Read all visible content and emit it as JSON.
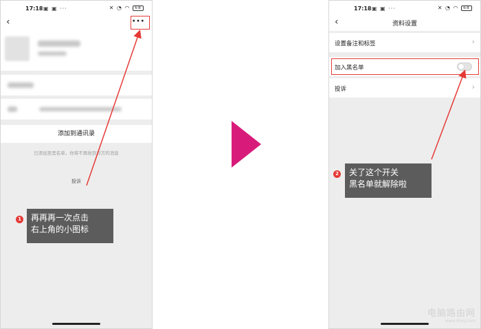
{
  "status_bar": {
    "time": "17:18",
    "battery": "68"
  },
  "left_phone": {
    "add_contact_label": "添加到通讯录",
    "blacklist_hint": "已添加至黑名单，你将不再收到对方的消息",
    "complain_link": "投诉",
    "more_icon": "···"
  },
  "right_phone": {
    "title": "资料设置",
    "rows": [
      {
        "label": "设置备注和标签"
      },
      {
        "label": "加入黑名单"
      },
      {
        "label": "投诉"
      }
    ]
  },
  "callouts": [
    {
      "badge": "1",
      "line1": "再再再一次点击",
      "line2": "右上角的小图标"
    },
    {
      "badge": "2",
      "line1": "关了这个开关",
      "line2": "黑名单就解除啦"
    }
  ],
  "watermark": {
    "line1": "电脑路由网",
    "line2": "www.dnxy.com"
  },
  "colors": {
    "accent_red": "#e53935",
    "step_arrow": "#d81b7b",
    "callout_bg": "#5c5c5c"
  }
}
